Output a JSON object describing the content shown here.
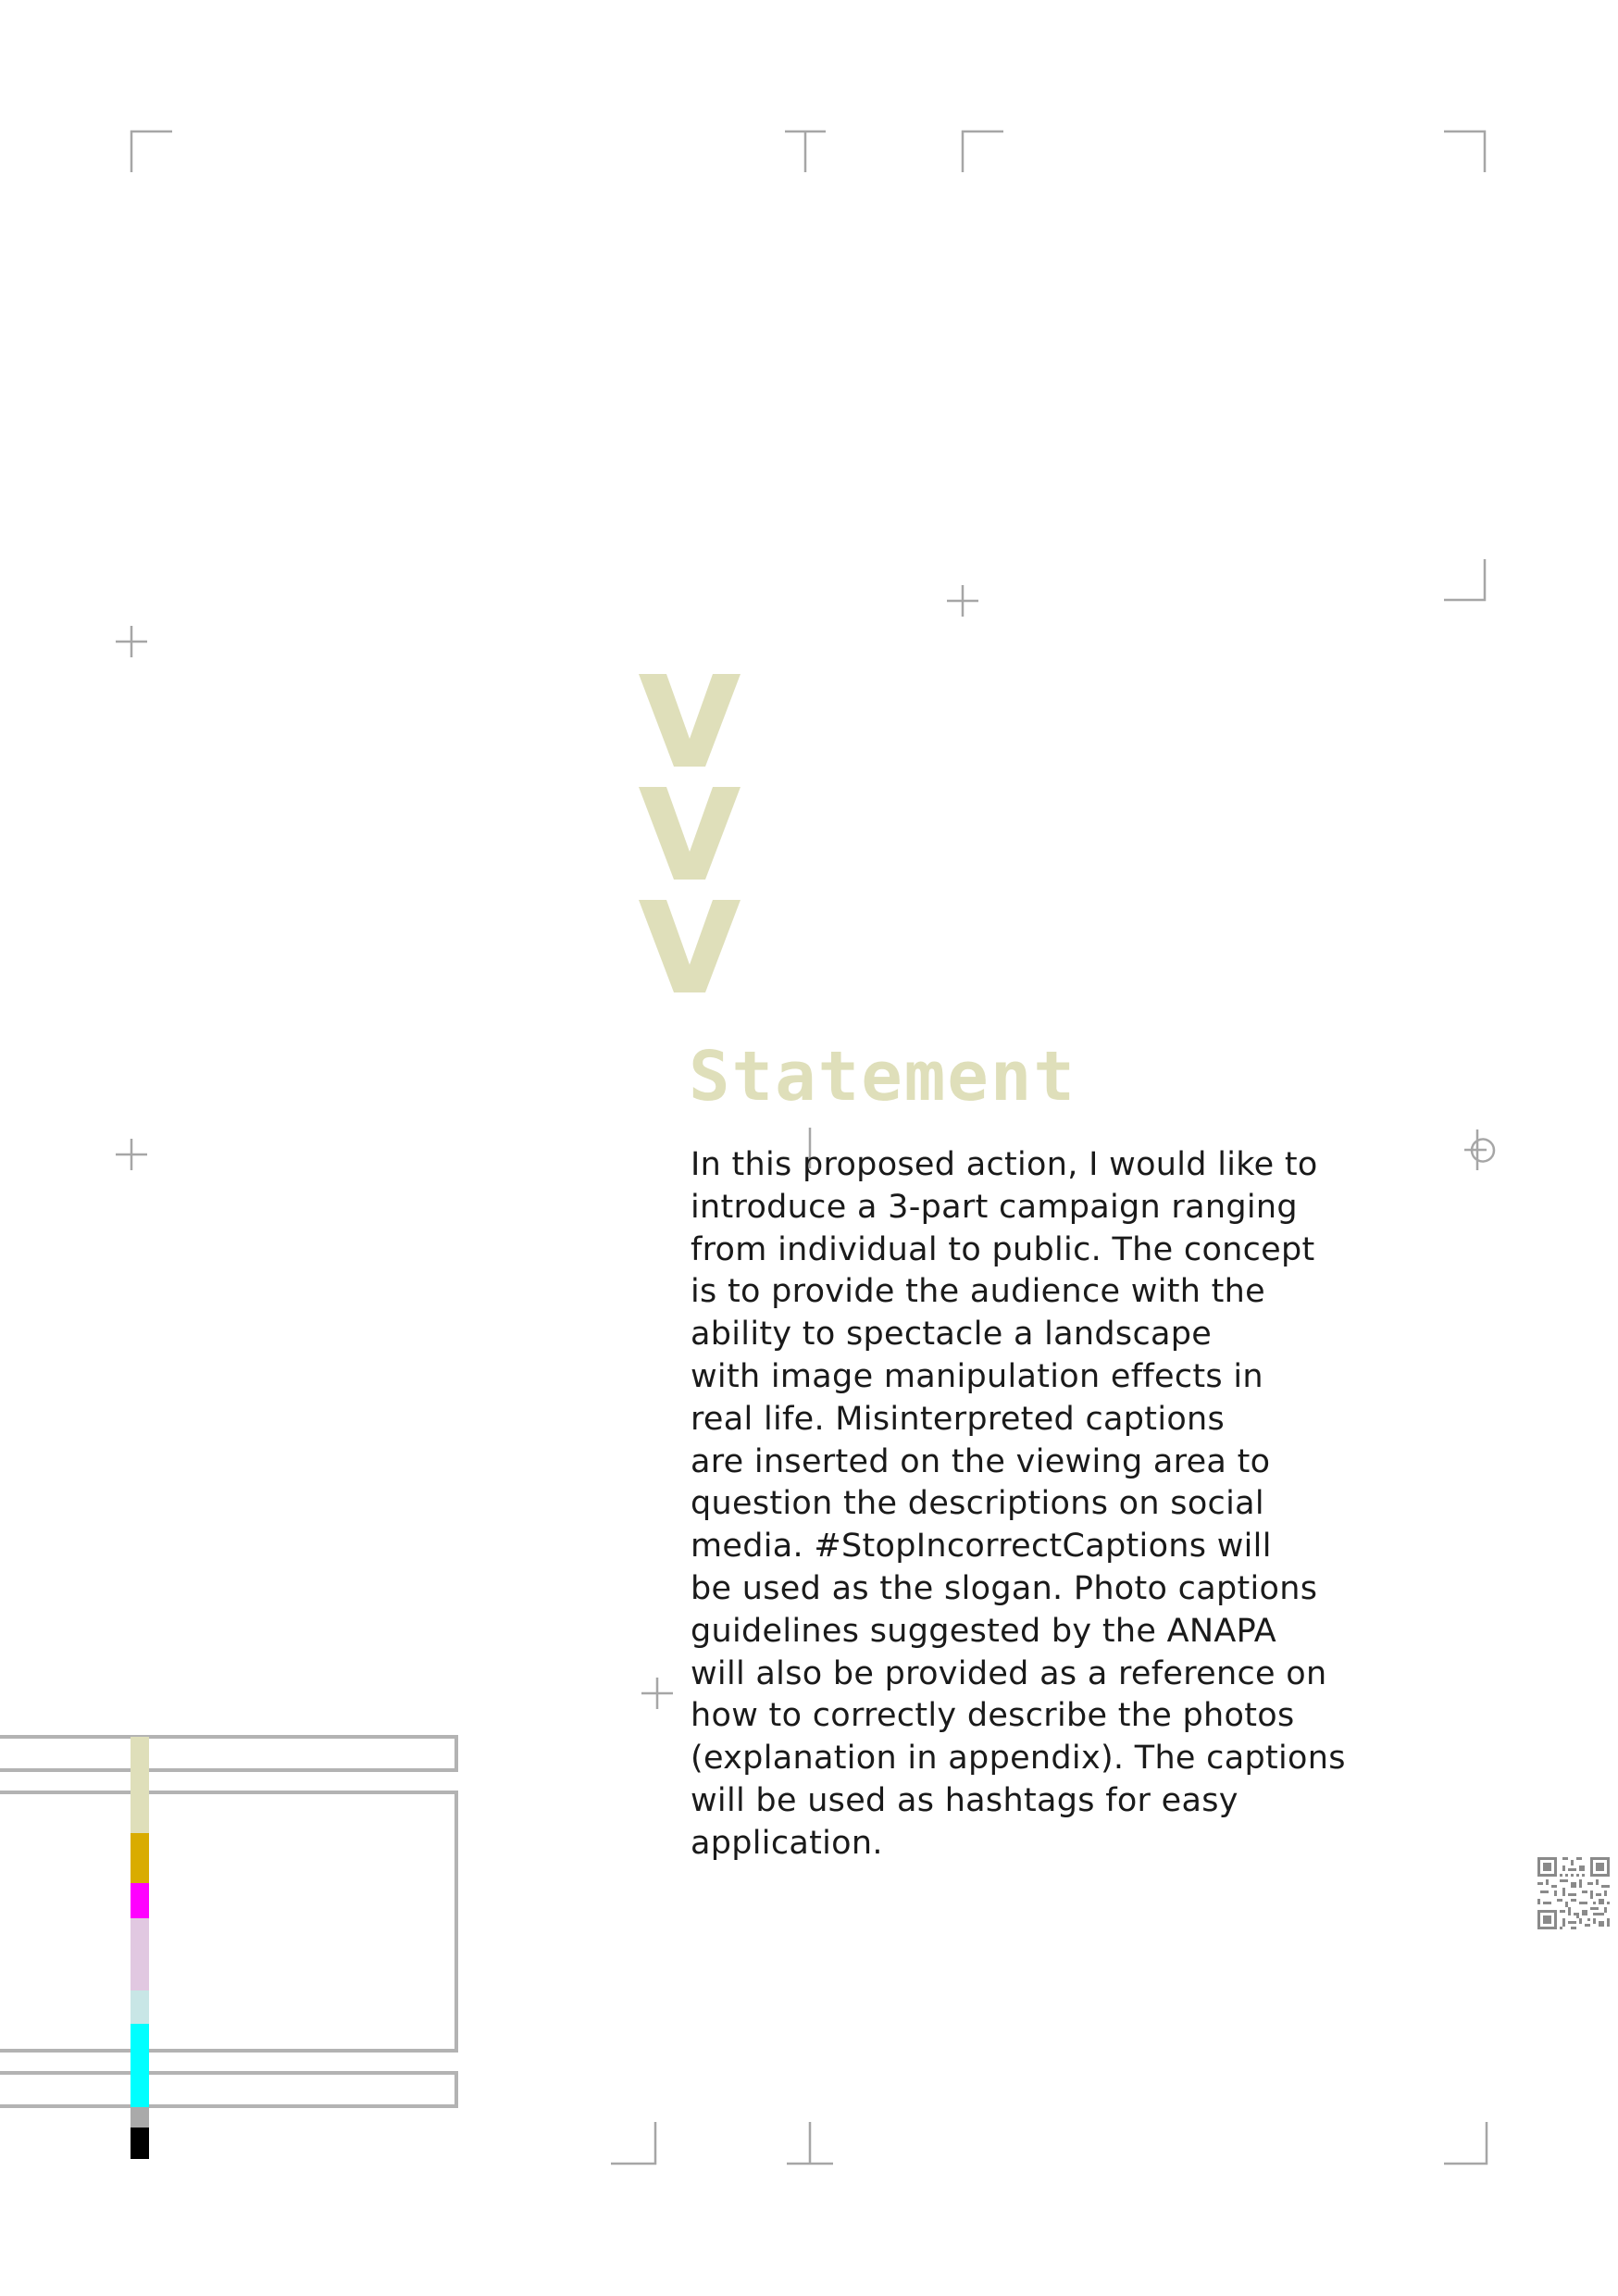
{
  "document": {
    "heading": "Statement",
    "paragraph_lines": [
      "In this proposed action, I would like to",
      "introduce a 3-part campaign ranging",
      "from individual to public. The concept",
      "is to provide the audience with the",
      "ability to spectacle a landscape",
      "with image manipulation effects in",
      "real life. Misinterpreted captions",
      "are inserted on the viewing area to",
      "question the descriptions on social",
      "media. #StopIncorrectCaptions will",
      "be used as the slogan. Photo captions",
      "guidelines suggested by the ANAPA",
      "will also be provided as a reference on",
      "how to correctly describe the photos",
      "(explanation in appendix). The captions",
      "will be used as hashtags for easy",
      "application."
    ]
  },
  "colors": {
    "accent": "#dfdfba",
    "text": "#1a1a1a",
    "crop_marks": "#a6a6a6",
    "color_bar": [
      "#dfdfba",
      "#d9ac00",
      "#ff00ff",
      "#e1c8e1",
      "#c8e6e6",
      "#00ffff",
      "#aaaaaa",
      "#000000"
    ]
  },
  "icons": {
    "chevrons": "triple-down-chevron-icon",
    "qr": "qr-code-icon"
  }
}
